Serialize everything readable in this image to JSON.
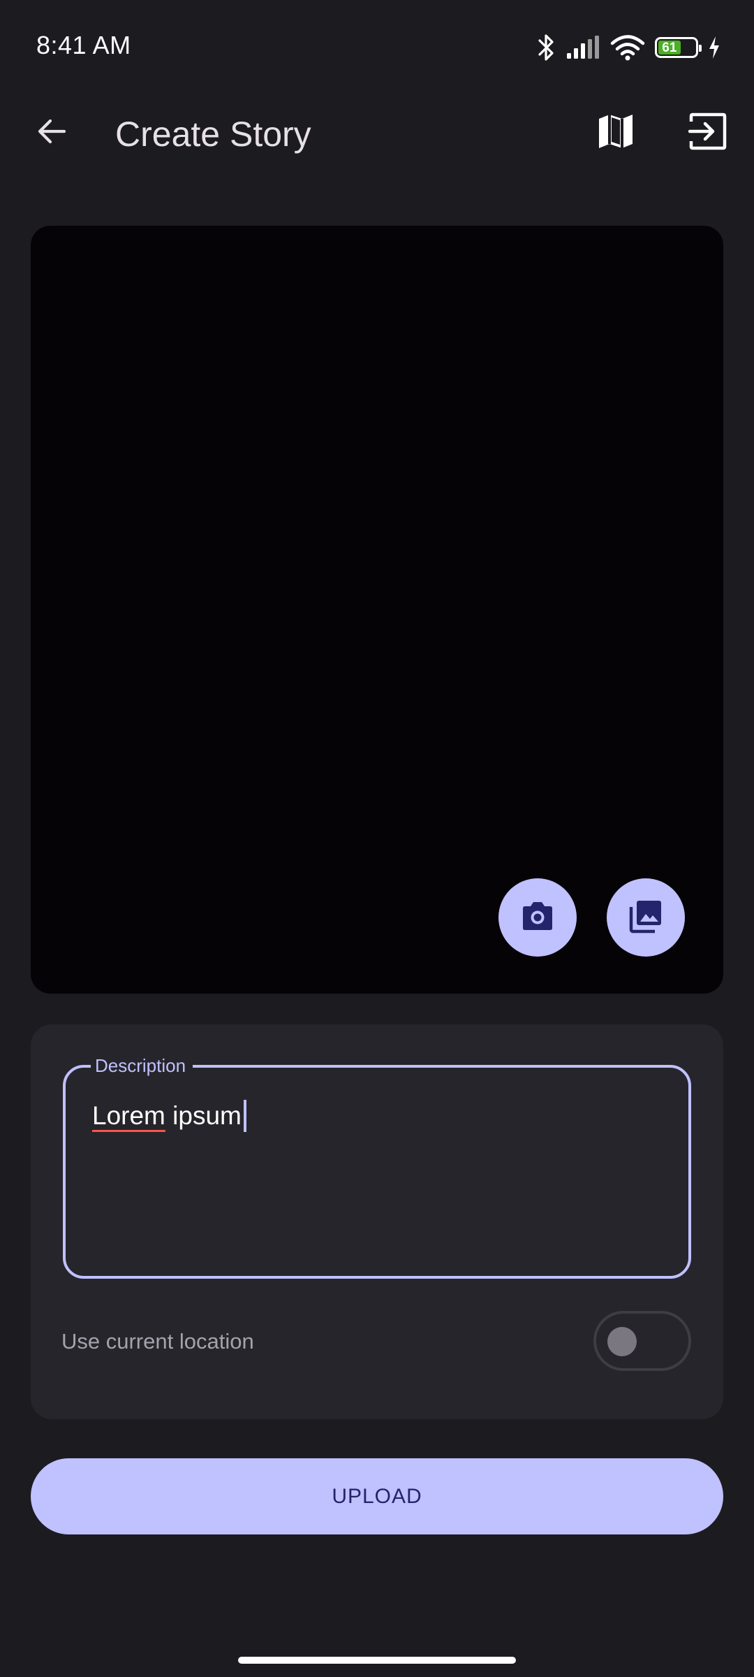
{
  "status_bar": {
    "time": "8:41 AM",
    "battery_level": "61",
    "battery_color": "#4caf26",
    "icons": [
      "bluetooth-icon",
      "signal-icon",
      "wifi-icon",
      "battery-icon",
      "charging-icon"
    ]
  },
  "app_bar": {
    "title": "Create Story",
    "back_icon": "arrow-back-icon",
    "actions": [
      "map-icon",
      "logout-icon"
    ]
  },
  "preview": {
    "camera_icon": "camera-icon",
    "gallery_icon": "photo-library-icon"
  },
  "form": {
    "description": {
      "label": "Description",
      "value_first_word": "Lorem",
      "value_rest": " ipsum"
    },
    "location": {
      "label": "Use current location",
      "enabled": false
    }
  },
  "upload_button": {
    "label": "UPLOAD"
  },
  "colors": {
    "background": "#1c1b20",
    "accent": "#c0c1ff",
    "on_accent": "#23246b",
    "card": "#26252b",
    "spellcheck": "#ff5449"
  }
}
